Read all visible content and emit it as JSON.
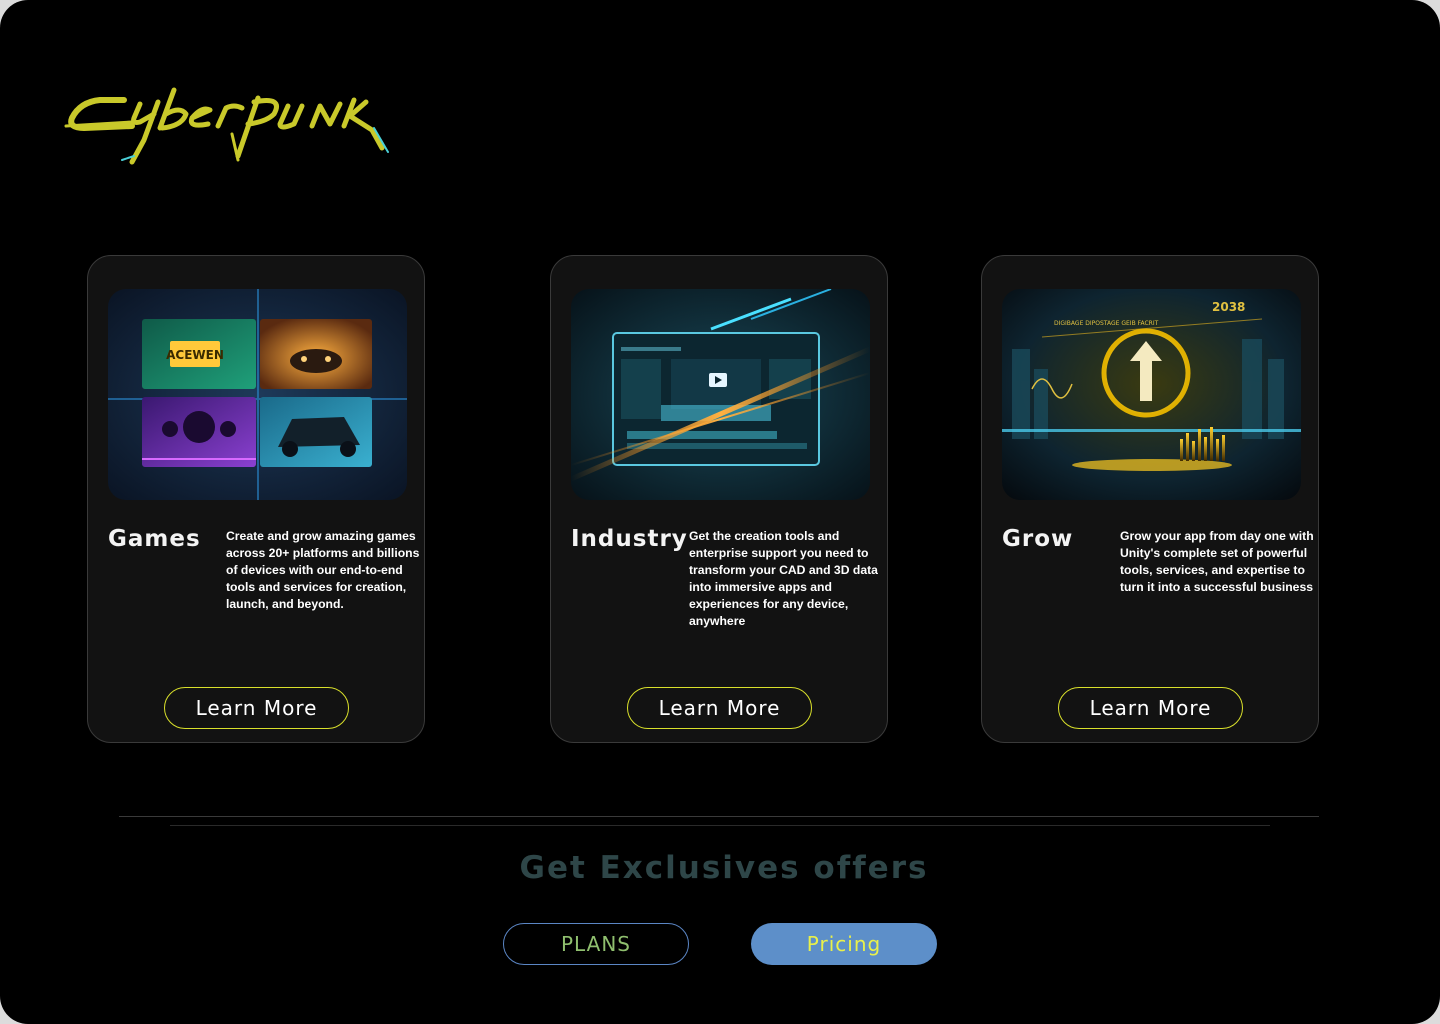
{
  "brand": {
    "logo_text": "Cyberpunk",
    "logo_color": "#c9c92a",
    "logo_accent": "#4ad0d8"
  },
  "cards": [
    {
      "title": "Games",
      "description": "Create and grow amazing games across 20+ platforms and billions of devices with our end-to-end tools and services for creation, launch, and beyond.",
      "button_label": "Learn More",
      "image_theme": "game-grid"
    },
    {
      "title": "Industry",
      "description": "Get the creation tools and enterprise support you need to transform your CAD and 3D data into immersive apps and experiences for any device, anywhere",
      "button_label": "Learn More",
      "image_theme": "video-editor"
    },
    {
      "title": "Grow",
      "description": "Grow your app from day one with Unity's complete set of powerful tools, services, and expertise to turn it into a successful business",
      "button_label": "Learn More",
      "image_theme": "growth-arrow"
    }
  ],
  "offers": {
    "title": "Get Exclusives offers",
    "buttons": [
      {
        "label": "PLANS"
      },
      {
        "label": "Pricing"
      }
    ]
  },
  "colors": {
    "accent_yellow": "#d9e02b",
    "pricing_bg": "#5d8fc9",
    "plans_border": "#5b86c5"
  }
}
